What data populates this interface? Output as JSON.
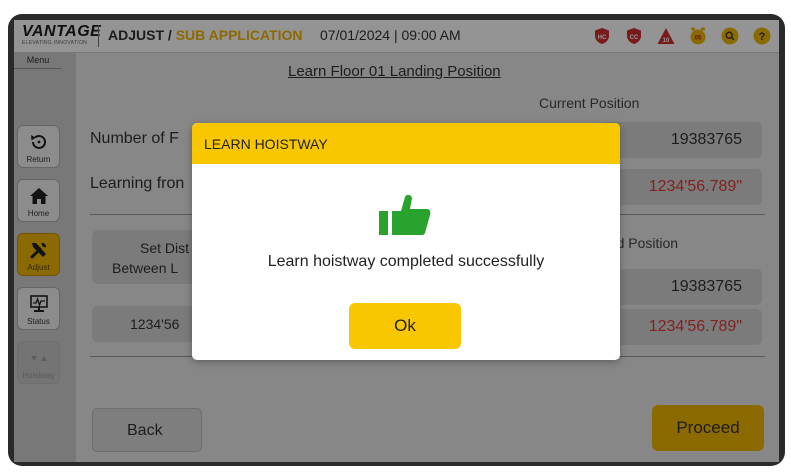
{
  "app": {
    "logo": "VANTAGE",
    "logo_tagline": "ELEVATING INNOVATION"
  },
  "header": {
    "crumb_main": "ADJUST",
    "crumb_sep": "/",
    "crumb_sub": "SUB APPLICATION",
    "datetime": "07/01/2024 | 09:00 AM",
    "icons": [
      {
        "name": "hc-shield-icon",
        "text": "HC",
        "color": "#d32f2f"
      },
      {
        "name": "cc-shield-icon",
        "text": "CC",
        "color": "#d32f2f"
      },
      {
        "name": "warning-10-icon",
        "text": "10",
        "color": "#d32f2f"
      },
      {
        "name": "alarm-05-icon",
        "text": "05",
        "color": "#f2b705"
      },
      {
        "name": "search-icon",
        "text": "",
        "color": "#f2b705"
      },
      {
        "name": "help-icon",
        "text": "?",
        "color": "#f2b705"
      }
    ]
  },
  "sidebar": {
    "menu_label": "Menu",
    "items": [
      {
        "label": "Return",
        "state": "normal"
      },
      {
        "label": "Home",
        "state": "normal"
      },
      {
        "label": "Adjust",
        "state": "active"
      },
      {
        "label": "Status",
        "state": "normal"
      },
      {
        "label": "Hoistway",
        "state": "disabled"
      }
    ]
  },
  "main": {
    "title": "Learn Floor 01 Landing Position",
    "current_position_label": "Current Position",
    "number_of_floors_label": "Number of F",
    "learning_from_label": "Learning fron",
    "current_value": "19383765",
    "current_value_ft": "1234'56.789\"",
    "learned_position_label": "ned Position",
    "set_distance_label_1": "Set Dist",
    "set_distance_label_2": "Between L",
    "set_distance_value": "1234'56",
    "learned_value": "19383765",
    "learned_value_ft": "1234'56.789\"",
    "back_label": "Back",
    "proceed_label": "Proceed"
  },
  "dialog": {
    "title": "LEARN HOISTWAY",
    "message": "Learn hoistway completed successfully",
    "ok_label": "Ok",
    "accent": "#f8c700",
    "thumb_color": "#2aa22e"
  }
}
